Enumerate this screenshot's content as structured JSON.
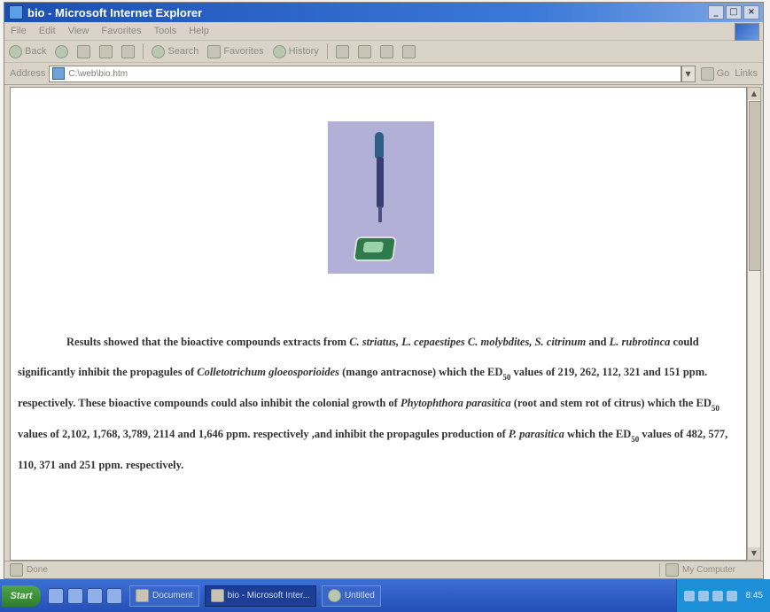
{
  "window": {
    "title": "bio - Microsoft Internet Explorer",
    "buttons": {
      "minimize": "_",
      "maximize": "□",
      "close": "×"
    }
  },
  "menubar": {
    "items": [
      "File",
      "Edit",
      "View",
      "Favorites",
      "Tools",
      "Help"
    ]
  },
  "toolbar": {
    "back": "Back",
    "search": "Search",
    "favorites": "Favorites",
    "history": "History"
  },
  "addressbar": {
    "label": "Address",
    "value": "C:\\web\\bio.htm",
    "go": "Go",
    "links": "Links"
  },
  "content": {
    "intro": "Results showed that the bioactive compounds extracts from ",
    "sp1": "C. striatus, L. cepaestipes C. molybdites, S. citrinum",
    "and1": " and ",
    "sp2": "L. rubrotinca",
    "mid1": " could significantly inhibit the propagules of ",
    "sp3": "Colletotrichum gloeosporioides",
    "mid2": " (mango antracnose) which the ED",
    "ed_sub": "50",
    "mid3": " values of 219, 262, 112, 321 and 151 ppm. respectively. These bioactive compounds could also inhibit the colonial growth of ",
    "sp4": "Phytophthora parasitica",
    "mid4": " (root and stem rot of citrus) which the ED",
    "mid5": " values of 2,102, 1,768, 3,789, 2114 and 1,646 ppm. respectively ,and inhibit the propagules production of ",
    "sp5": "P. parasitica",
    "mid6": " which the ED",
    "mid7": " values of 482, 577, 110, 371 and 251 ppm. respectively."
  },
  "statusbar": {
    "left": "Done",
    "zone": "My Computer"
  },
  "taskbar": {
    "start": "Start",
    "tasks": [
      "Document",
      "bio - Microsoft Inter...",
      "Untitled"
    ],
    "time": "8:45"
  }
}
